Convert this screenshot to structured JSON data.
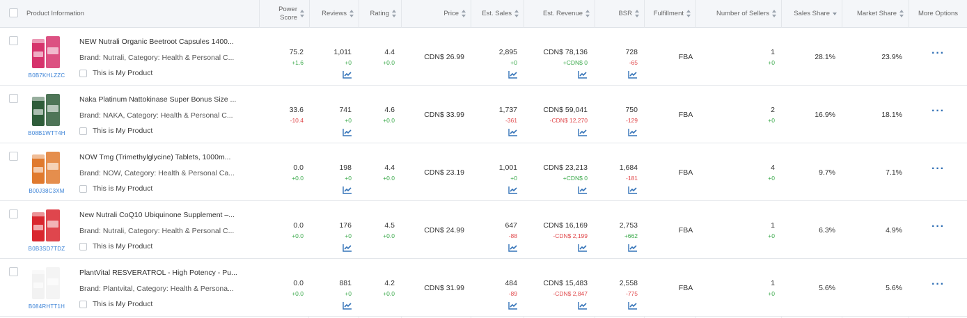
{
  "header": {
    "product_information": "Product Information",
    "power_score": "Power Score",
    "reviews": "Reviews",
    "rating": "Rating",
    "price": "Price",
    "est_sales": "Est. Sales",
    "est_revenue": "Est. Revenue",
    "bsr": "BSR",
    "fulfillment": "Fulfillment",
    "number_of_sellers": "Number of Sellers",
    "sales_share": "Sales Share",
    "market_share": "Market Share",
    "more_options": "More Options"
  },
  "rows": [
    {
      "asin": "B0B7KHLZZC",
      "title": "NEW Nutrali Organic Beetroot Capsules 1400...",
      "brand_line": "Brand: Nutrali,  Category: Health & Personal C...",
      "my_product": "This is My Product",
      "power_score": "75.2",
      "power_delta": "+1.6",
      "reviews": "1,011",
      "reviews_delta": "+0",
      "rating": "4.4",
      "rating_delta": "+0.0",
      "price": "CDN$ 26.99",
      "sales": "2,895",
      "sales_delta": "+0",
      "revenue": "CDN$ 78,136",
      "revenue_delta": "+CDN$ 0",
      "bsr": "728",
      "bsr_delta": "-65",
      "fulfillment": "FBA",
      "sellers": "1",
      "sellers_delta": "+0",
      "sales_share": "28.1%",
      "market_share": "23.9%",
      "thumb_color": "#d6336c"
    },
    {
      "asin": "B08B1WTT4H",
      "title": "Naka Platinum Nattokinase Super Bonus Size ...",
      "brand_line": "Brand: NAKA,  Category: Health & Personal C...",
      "my_product": "This is My Product",
      "power_score": "33.6",
      "power_delta": "-10.4",
      "reviews": "741",
      "reviews_delta": "+0",
      "rating": "4.6",
      "rating_delta": "+0.0",
      "price": "CDN$ 33.99",
      "sales": "1,737",
      "sales_delta": "-361",
      "revenue": "CDN$ 59,041",
      "revenue_delta": "-CDN$ 12,270",
      "bsr": "750",
      "bsr_delta": "-129",
      "fulfillment": "FBA",
      "sellers": "2",
      "sellers_delta": "+0",
      "sales_share": "16.9%",
      "market_share": "18.1%",
      "thumb_color": "#2f5d3a"
    },
    {
      "asin": "B00J38C3XM",
      "title": "NOW Tmg (Trimethylglycine) Tablets, 1000m...",
      "brand_line": "Brand: NOW,  Category: Health & Personal Ca...",
      "my_product": "This is My Product",
      "power_score": "0.0",
      "power_delta": "+0.0",
      "reviews": "198",
      "reviews_delta": "+0",
      "rating": "4.4",
      "rating_delta": "+0.0",
      "price": "CDN$ 23.19",
      "sales": "1,001",
      "sales_delta": "+0",
      "revenue": "CDN$ 23,213",
      "revenue_delta": "+CDN$ 0",
      "bsr": "1,684",
      "bsr_delta": "-181",
      "fulfillment": "FBA",
      "sellers": "4",
      "sellers_delta": "+0",
      "sales_share": "9.7%",
      "market_share": "7.1%",
      "thumb_color": "#e07a2e"
    },
    {
      "asin": "B0B3SD7TDZ",
      "title": "New Nutrali CoQ10 Ubiquinone Supplement –...",
      "brand_line": "Brand: Nutrali,  Category: Health & Personal C...",
      "my_product": "This is My Product",
      "power_score": "0.0",
      "power_delta": "+0.0",
      "reviews": "176",
      "reviews_delta": "+0",
      "rating": "4.5",
      "rating_delta": "+0.0",
      "price": "CDN$ 24.99",
      "sales": "647",
      "sales_delta": "-88",
      "revenue": "CDN$ 16,169",
      "revenue_delta": "-CDN$ 2,199",
      "bsr": "2,753",
      "bsr_delta": "+662",
      "fulfillment": "FBA",
      "sellers": "1",
      "sellers_delta": "+0",
      "sales_share": "6.3%",
      "market_share": "4.9%",
      "thumb_color": "#d9262e"
    },
    {
      "asin": "B084RHTT1H",
      "title": "PlantVital RESVERATROL - High Potency - Pu...",
      "brand_line": "Brand: Plantvital,  Category: Health & Persona...",
      "my_product": "This is My Product",
      "power_score": "0.0",
      "power_delta": "+0.0",
      "reviews": "881",
      "reviews_delta": "+0",
      "rating": "4.2",
      "rating_delta": "+0.0",
      "price": "CDN$ 31.99",
      "sales": "484",
      "sales_delta": "-89",
      "revenue": "CDN$ 15,483",
      "revenue_delta": "-CDN$ 2,847",
      "bsr": "2,558",
      "bsr_delta": "-775",
      "fulfillment": "FBA",
      "sellers": "1",
      "sellers_delta": "+0",
      "sales_share": "5.6%",
      "market_share": "5.6%",
      "thumb_color": "#f2f2f2"
    }
  ],
  "colors": {
    "positive": "#3aa94a",
    "negative": "#e0484b",
    "link": "#3b82d6",
    "header_bg": "#f4f6f9"
  },
  "icons": {
    "trend": "trend-chart-icon",
    "more": "more-options-icon"
  }
}
